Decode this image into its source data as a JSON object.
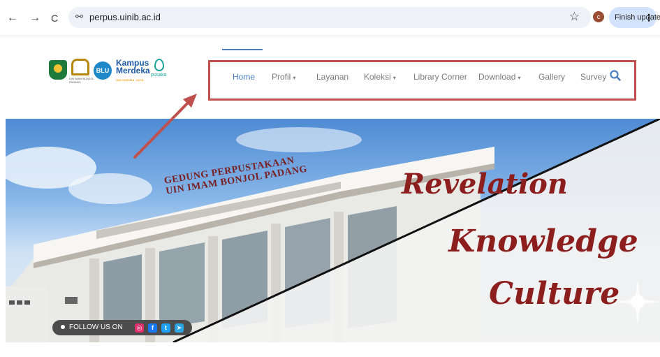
{
  "browser": {
    "url": "perpus.uinib.ac.id",
    "profile_initial": "c",
    "update_button": "Finish update",
    "back_icon": "←",
    "forward_icon": "→",
    "reload_icon": "C",
    "site_settings_icon": "⚯",
    "bookmark_icon": "☆",
    "menu_icon": "⋮"
  },
  "logos": {
    "uin_text": "UIN IMAM BONJOL PADANG",
    "blu": "BLU",
    "kampus_merdeka_line1": "Kampus",
    "kampus_merdeka_line2": "Merdeka",
    "kampus_merdeka_sub": "INDONESIA JAYA",
    "pusaka": "pusaka"
  },
  "nav": {
    "items": [
      {
        "label": "Home",
        "active": true
      },
      {
        "label": "Profil",
        "dropdown": true
      },
      {
        "label": "Layanan"
      },
      {
        "label": "Koleksi",
        "dropdown": true
      },
      {
        "label": "Library Corner"
      },
      {
        "label": "Download",
        "dropdown": true
      },
      {
        "label": "Gallery"
      },
      {
        "label": "Survey"
      }
    ],
    "caret": "▾",
    "search_icon": "search-icon",
    "active_color": "#4a7fc4",
    "highlight_color": "#c0504d"
  },
  "hero": {
    "building_line1": "GEDUNG PERPUSTAKAAN",
    "building_line2": "UIN IMAM BONJOL PADANG",
    "slogan": [
      "Revelation",
      "Knowledge",
      "Culture"
    ],
    "slogan_color": "#8d1e1e",
    "follow_text": "FOLLOW US ON",
    "social": [
      {
        "name": "instagram-icon",
        "glyph": "◎",
        "color": "#e1306c"
      },
      {
        "name": "facebook-icon",
        "glyph": "f",
        "color": "#1877f2"
      },
      {
        "name": "twitter-icon",
        "glyph": "t",
        "color": "#1da1f2"
      },
      {
        "name": "telegram-icon",
        "glyph": "➤",
        "color": "#2ca5e0"
      }
    ]
  }
}
